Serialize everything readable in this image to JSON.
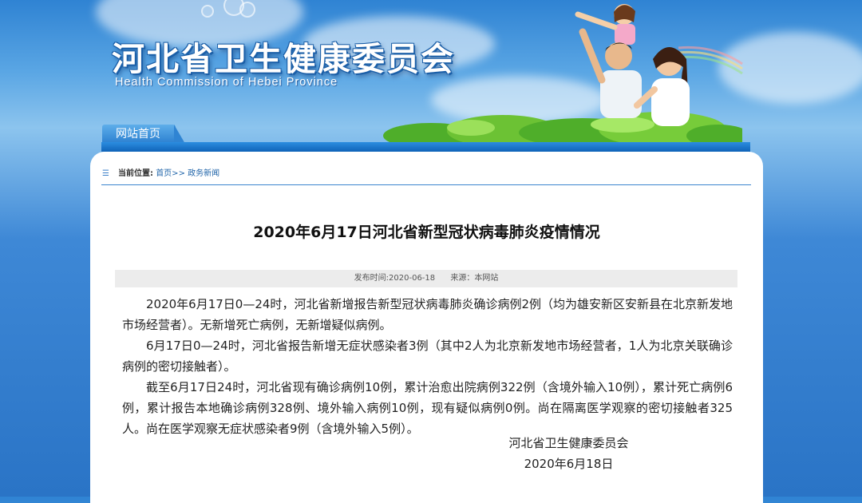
{
  "header": {
    "title": "河北省卫生健康委员会",
    "subtitle": "Health Commission of Hebei Province"
  },
  "nav": {
    "home_tab": "网站首页"
  },
  "breadcrumb": {
    "icon": "list-icon",
    "label": "当前位置:",
    "home": "首页>>",
    "section": "政务新闻"
  },
  "article": {
    "title": "2020年6月17日河北省新型冠状病毒肺炎疫情情况",
    "meta": {
      "published": "发布时间:2020-06-18",
      "source": "来源：本网站"
    },
    "paragraphs": [
      "2020年6月17日0—24时，河北省新增报告新型冠状病毒肺炎确诊病例2例（均为雄安新区安新县在北京新发地市场经营者）。无新增死亡病例，无新增疑似病例。",
      "6月17日0—24时，河北省报告新增无症状感染者3例（其中2人为北京新发地市场经营者，1人为北京关联确诊病例的密切接触者）。",
      "截至6月17日24时，河北省现有确诊病例10例，累计治愈出院病例322例（含境外输入10例），累计死亡病例6例，累计报告本地确诊病例328例、境外输入病例10例，现有疑似病例0例。尚在隔离医学观察的密切接触者325人。尚在医学观察无症状感染者9例（含境外输入5例）。"
    ],
    "signoff_org": "河北省卫生健康委员会",
    "signoff_date": "2020年6月18日"
  },
  "colors": {
    "nav_blue": "#0f63b8",
    "link": "#2266aa"
  }
}
